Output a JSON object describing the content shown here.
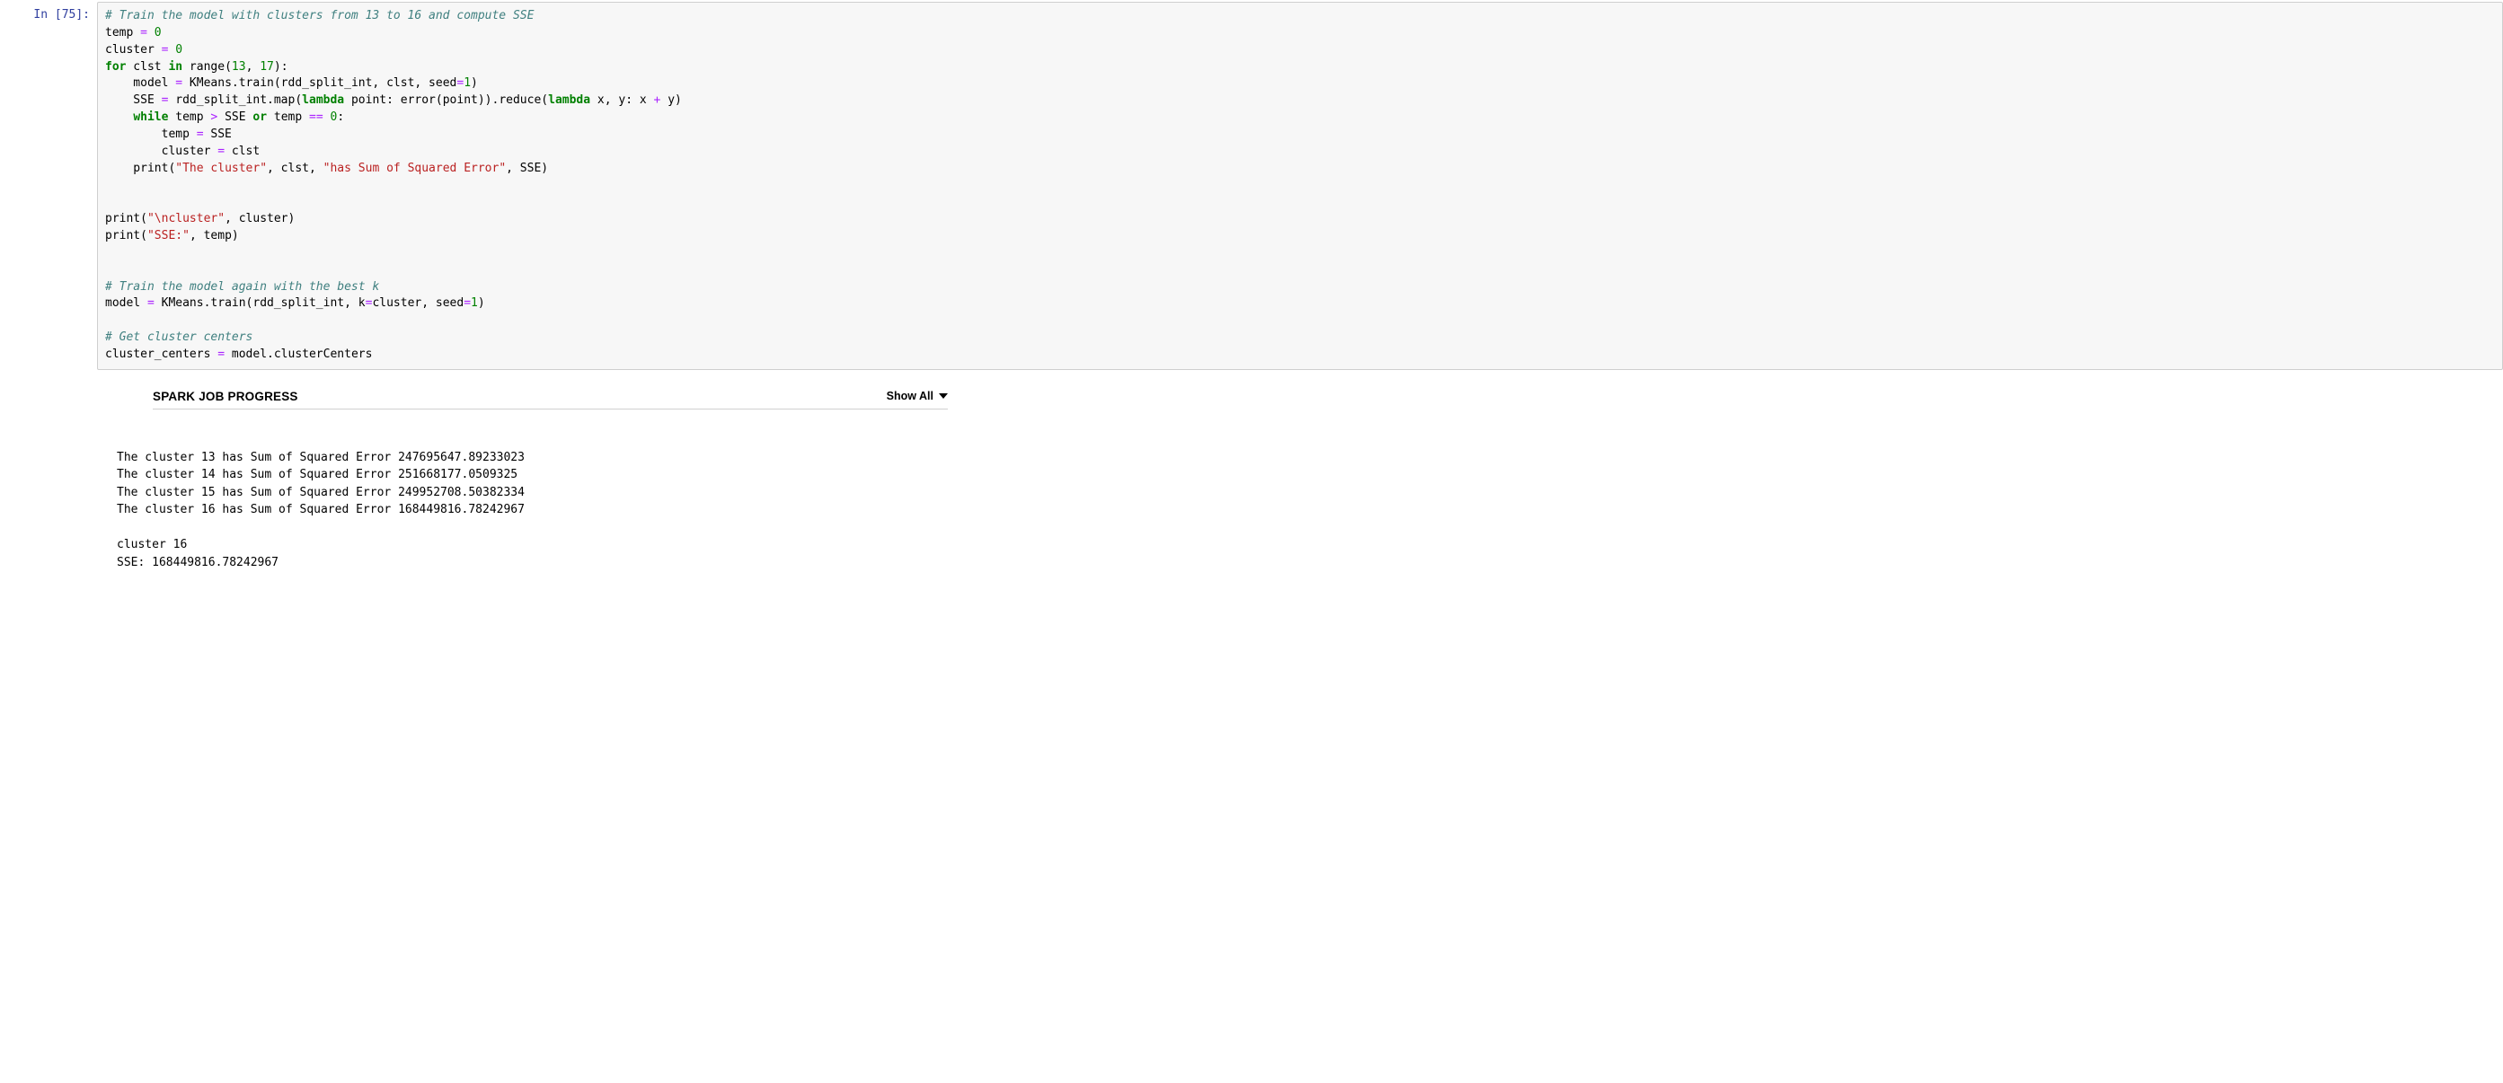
{
  "cell": {
    "prompt_label": "In",
    "prompt_number": "75",
    "code": {
      "l01_comment": "# Train the model with clusters from 13 to 16 and compute SSE",
      "l02a": "temp ",
      "l02b": " ",
      "l02c": "0",
      "l03a": "cluster ",
      "l03b": " ",
      "l03c": "0",
      "l04_for": "for",
      "l04_sp1": " clst ",
      "l04_in": "in",
      "l04_sp2": " range(",
      "l04_n1": "13",
      "l04_sp3": ", ",
      "l04_n2": "17",
      "l04_sp4": "):",
      "l05": "    model ",
      "l05b": " KMeans.train(rdd_split_int, clst, seed",
      "l05n": "1",
      "l05c": ")",
      "l06a": "    SSE ",
      "l06b": " rdd_split_int.map(",
      "l06_lambda1": "lambda",
      "l06c": " point: error(point)).reduce(",
      "l06_lambda2": "lambda",
      "l06d": " x, y: x ",
      "l06e": " y)",
      "l07_while": "while",
      "l07a": " temp ",
      "l07b": " SSE ",
      "l07_or": "or",
      "l07c": " temp ",
      "l07d": " ",
      "l07n": "0",
      "l07e": ":",
      "l08": "        temp ",
      "l08b": " SSE",
      "l09": "        cluster ",
      "l09b": " clst",
      "l10a": "    print(",
      "l10s1": "\"The cluster\"",
      "l10b": ", clst, ",
      "l10s2": "\"has Sum of Squared Error\"",
      "l10c": ", SSE)",
      "l11a": "print(",
      "l11s": "\"\\ncluster\"",
      "l11b": ", cluster)",
      "l12a": "print(",
      "l12s": "\"SSE:\"",
      "l12b": ", temp)",
      "l13_comment": "# Train the model again with the best k",
      "l14a": "model ",
      "l14b": " KMeans.train(rdd_split_int, k",
      "l14c": "cluster, seed",
      "l14n": "1",
      "l14d": ")",
      "l15_comment": "# Get cluster centers",
      "l16a": "cluster_centers ",
      "l16b": " model.clusterCenters"
    }
  },
  "spark": {
    "title": "SPARK JOB PROGRESS",
    "show_all": "Show All"
  },
  "stdout_lines": [
    "The cluster 13 has Sum of Squared Error 247695647.89233023",
    "The cluster 14 has Sum of Squared Error 251668177.0509325",
    "The cluster 15 has Sum of Squared Error 249952708.50382334",
    "The cluster 16 has Sum of Squared Error 168449816.78242967",
    "",
    "cluster 16",
    "SSE: 168449816.78242967"
  ]
}
